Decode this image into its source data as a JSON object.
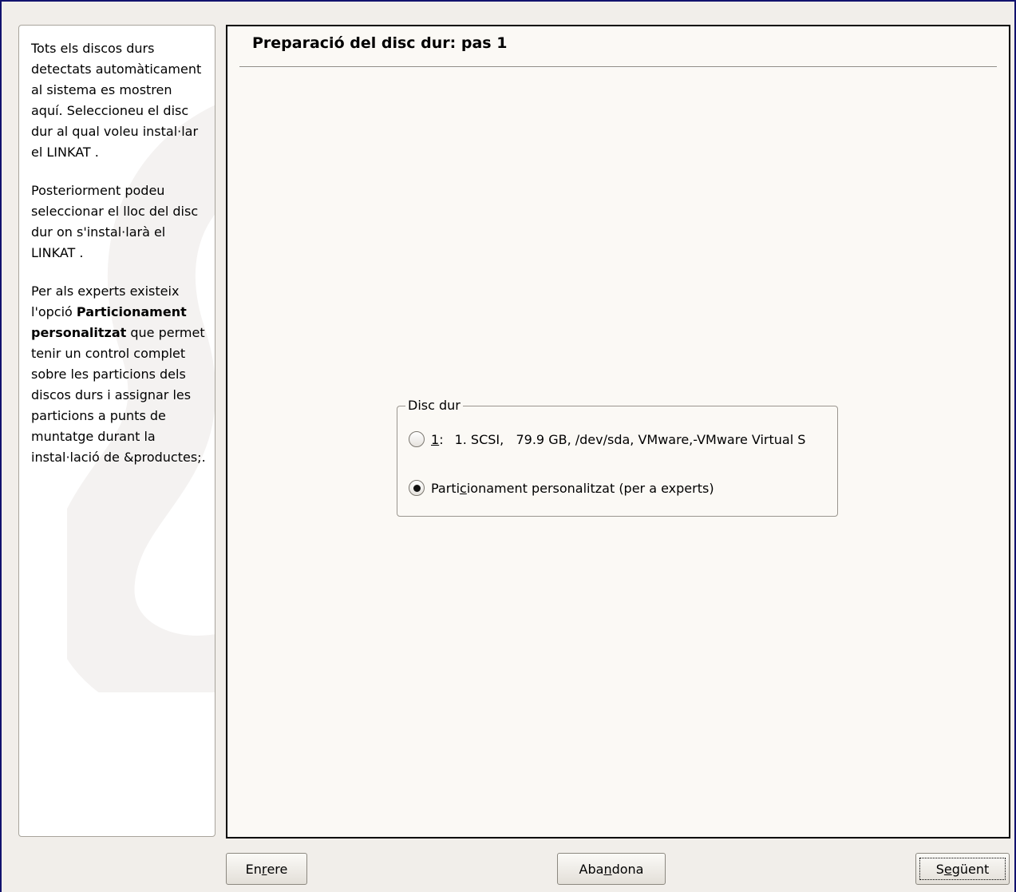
{
  "help": {
    "paragraph1": "Tots els discos durs detectats automàticament al sistema es mostren aquí. Seleccioneu el disc dur al qual voleu instal·lar el LINKAT .",
    "paragraph2": "Posteriorment podeu seleccionar el lloc del disc dur on s'instal·larà el LINKAT .",
    "paragraph3_pre": "Per als experts existeix l'opció ",
    "paragraph3_bold": "Particionament personalitzat",
    "paragraph3_post": " que permet tenir un control complet sobre les particions dels discos durs i assignar les particions a punts de muntatge durant la instal·lació de &productes;."
  },
  "main": {
    "title": "Preparació del disc dur: pas 1",
    "disk_group": {
      "legend": "Disc dur",
      "options": [
        {
          "accel": "1",
          "sep": ":",
          "label": "1. SCSI,   79.9 GB, /dev/sda, VMware,-VMware Virtual S",
          "selected": false
        },
        {
          "label_pre": "Parti",
          "accel": "c",
          "label_post": "ionament personalitzat (per a experts)",
          "selected": true
        }
      ]
    }
  },
  "buttons": {
    "back": {
      "pre": "En",
      "accel": "r",
      "post": "ere"
    },
    "abort": {
      "pre": "Aba",
      "accel": "n",
      "post": "dona"
    },
    "next": {
      "pre": "S",
      "accel": "e",
      "post": "güent"
    }
  },
  "colors": {
    "window_border": "#12126e",
    "background": "#f1eeea",
    "panel": "#fbf9f5"
  }
}
